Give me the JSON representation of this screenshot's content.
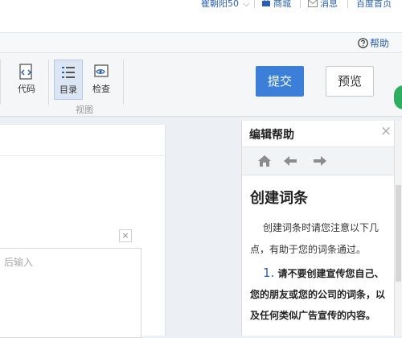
{
  "topbar": {
    "user_name": "崔朝阳50",
    "mall_label": "商城",
    "message_label": "消息",
    "homepage_label": "百度首页"
  },
  "helpbar": {
    "help_label": "帮助"
  },
  "toolbar": {
    "code_label": "代码",
    "toc_label": "目录",
    "check_label": "检查",
    "view_group_label": "视图",
    "submit_label": "提交",
    "preview_label": "预览"
  },
  "editor": {
    "input_placeholder": "后输入"
  },
  "help_panel": {
    "title": "编辑帮助",
    "content_heading": "创建词条",
    "paragraph1": "创建词条时请您注意以下几点，有助于您的词条通过。",
    "list_item_number": "1.",
    "list_item_text": "请不要创建宣传您自己、您的朋友或您的公司的词条，以及任何类似广告宣传的内容。"
  },
  "colors": {
    "accent": "#3b7fd9",
    "link": "#2b5fb4",
    "edge_green": "#2fae61"
  }
}
